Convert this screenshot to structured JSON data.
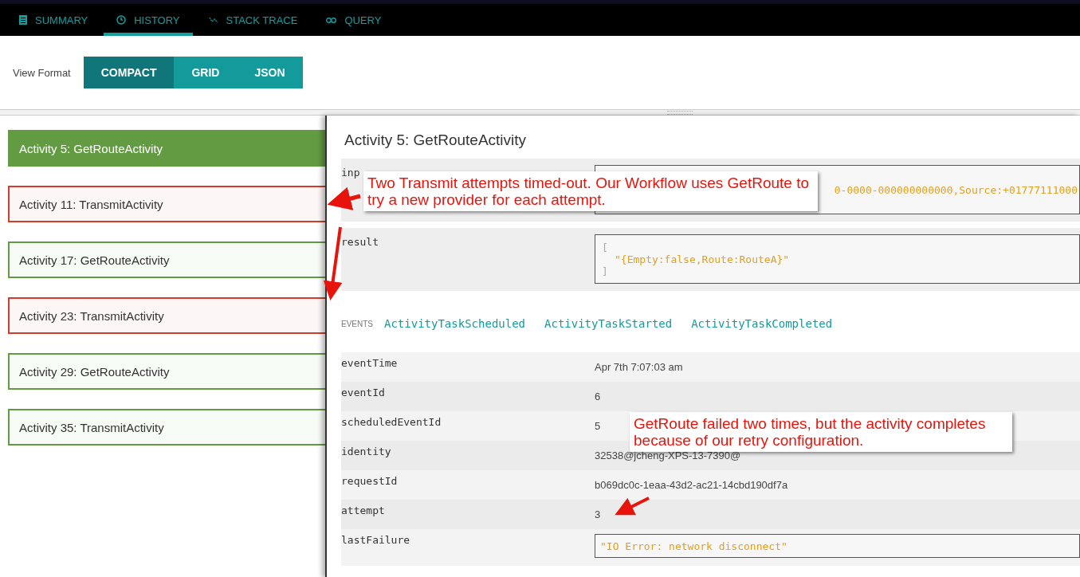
{
  "tabs": [
    {
      "label": "SUMMARY",
      "selected": false
    },
    {
      "label": "HISTORY",
      "selected": true
    },
    {
      "label": "STACK TRACE",
      "selected": false
    },
    {
      "label": "QUERY",
      "selected": false
    }
  ],
  "view_format": {
    "label": "View Format",
    "options": [
      {
        "label": "COMPACT",
        "selected": true
      },
      {
        "label": "GRID",
        "selected": false
      },
      {
        "label": "JSON",
        "selected": false
      }
    ]
  },
  "activities": [
    {
      "label": "Activity 5: GetRouteActivity",
      "failed": false,
      "selected": true
    },
    {
      "label": "Activity 11: TransmitActivity",
      "failed": true,
      "selected": false
    },
    {
      "label": "Activity 17: GetRouteActivity",
      "failed": false,
      "selected": false
    },
    {
      "label": "Activity 23: TransmitActivity",
      "failed": true,
      "selected": false
    },
    {
      "label": "Activity 29: GetRouteActivity",
      "failed": false,
      "selected": false
    },
    {
      "label": "Activity 35: TransmitActivity",
      "failed": false,
      "selected": false
    }
  ],
  "detail": {
    "title": "Activity 5: GetRouteActivity",
    "fields": [
      {
        "key": "inp",
        "kind": "json-line",
        "value": "0-0000-000000000000,Source:+01777111000"
      },
      {
        "key": "result",
        "kind": "json-array",
        "open": "[",
        "value": "\"{Empty:false,Route:RouteA}\"",
        "close": "]"
      }
    ],
    "events_label": "EVENTS",
    "events": [
      "ActivityTaskScheduled",
      "ActivityTaskStarted",
      "ActivityTaskCompleted"
    ],
    "event_fields": [
      {
        "key": "eventTime",
        "kind": "text",
        "value": "Apr 7th 7:07:03 am"
      },
      {
        "key": "eventId",
        "kind": "text",
        "value": "6"
      },
      {
        "key": "scheduledEventId",
        "kind": "text",
        "value": "5"
      },
      {
        "key": "identity",
        "kind": "text",
        "value": "32538@jcheng-XPS-13-7390@"
      },
      {
        "key": "requestId",
        "kind": "text",
        "value": "b069dc0c-1eaa-43d2-ac21-14cbd190df7a"
      },
      {
        "key": "attempt",
        "kind": "text",
        "value": "3"
      },
      {
        "key": "lastFailure",
        "kind": "json-line",
        "value": "\"IO Error: network disconnect\""
      }
    ]
  },
  "annotations": [
    {
      "text": "Two Transmit attempts timed-out. Our Workflow uses GetRoute to try a new provider for each attempt."
    },
    {
      "text": "GetRoute failed two times, but the activity completes because of our retry configuration."
    }
  ]
}
